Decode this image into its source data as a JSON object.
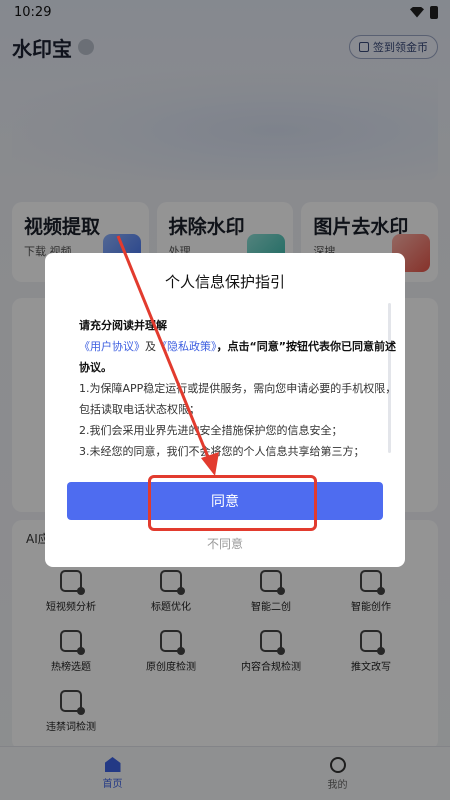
{
  "status_bar": {
    "time": "10:29"
  },
  "header": {
    "app_title": "水印宝",
    "signin_label": "签到领金币"
  },
  "feature_cards": [
    {
      "title": "视频提取",
      "subtitle": "下载 视频"
    },
    {
      "title": "抹除水印",
      "subtitle": "处理"
    },
    {
      "title": "图片去水印",
      "subtitle": "深搜"
    }
  ],
  "ai_section": {
    "title": "AI应",
    "tools": [
      {
        "label": "短视频分析",
        "icon": "video-analysis-icon"
      },
      {
        "label": "标题优化",
        "icon": "title-optimize-icon"
      },
      {
        "label": "智能二创",
        "icon": "smart-recreate-icon"
      },
      {
        "label": "智能创作",
        "icon": "smart-create-icon"
      },
      {
        "label": "热榜选题",
        "icon": "hot-topic-icon"
      },
      {
        "label": "原创度检测",
        "icon": "originality-check-icon"
      },
      {
        "label": "内容合规检测",
        "icon": "compliance-check-icon"
      },
      {
        "label": "推文改写",
        "icon": "tweet-rewrite-icon"
      },
      {
        "label": "违禁词检测",
        "icon": "banned-word-icon"
      }
    ]
  },
  "tabbar": {
    "home": "首页",
    "mine": "我的"
  },
  "dialog": {
    "title": "个人信息保护指引",
    "lead": "请充分阅读并理解",
    "user_agreement": "《用户协议》",
    "and": "及",
    "privacy_policy": "《隐私政策》",
    "consent_text": "，点击“同意”按钮代表你已同意前述协议。",
    "items": [
      "1.为保障APP稳定运行或提供服务，需向您申请必要的手机权限，包括读取电话状态权限；",
      "2.我们会采用业界先进的安全措施保护您的信息安全；",
      "3.未经您的同意，我们不会将您的个人信息共享给第三方；"
    ],
    "agree_label": "同意",
    "disagree_label": "不同意"
  },
  "colors": {
    "accent": "#4e6cf0",
    "annotation": "#e23b2e"
  }
}
